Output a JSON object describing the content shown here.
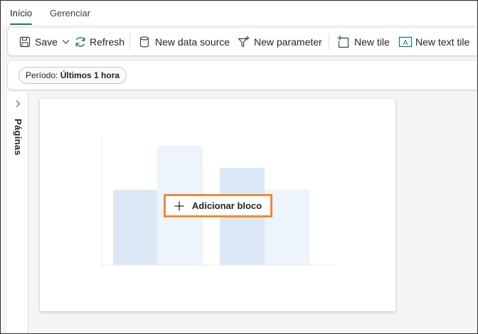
{
  "tabs": [
    {
      "label": "Início",
      "active": true
    },
    {
      "label": "Gerenciar",
      "active": false
    }
  ],
  "toolbar": {
    "save_label": "Save",
    "refresh_label": "Refresh",
    "new_data_source_label": "New data source",
    "new_parameter_label": "New parameter",
    "new_tile_label": "New tile",
    "new_text_tile_label": "New text tile"
  },
  "filter": {
    "prefix": "Período: ",
    "value": "Últimos 1 hora"
  },
  "pages_panel": {
    "label": "Páginas"
  },
  "canvas": {
    "add_tile_label": "Adicionar bloco"
  },
  "colors": {
    "accent": "#1b7a70",
    "highlight_border": "#ec8a3c",
    "placeholder_bar_dark": "#dce8f6",
    "placeholder_bar_light": "#edf4fc"
  },
  "icons": [
    "save-icon",
    "chevron-down-icon",
    "refresh-icon",
    "database-icon",
    "filter-add-icon",
    "add-tile-icon",
    "text-tile-icon",
    "chevron-right-icon",
    "plus-icon"
  ]
}
